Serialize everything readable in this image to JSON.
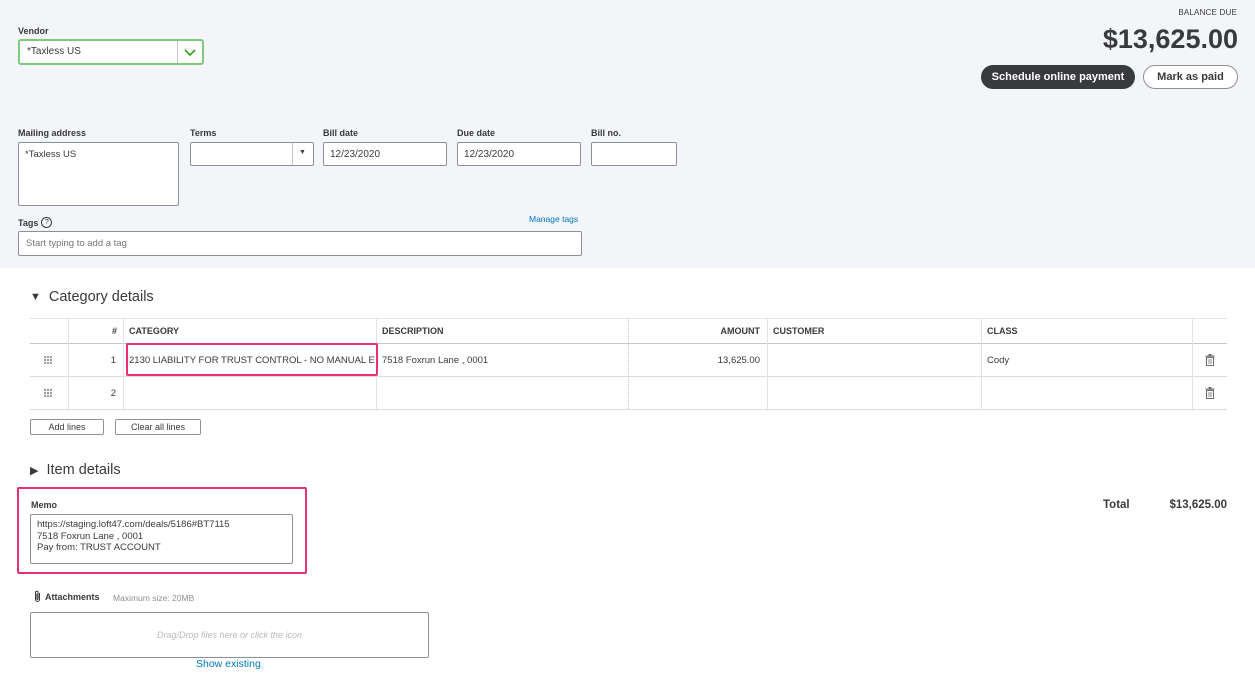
{
  "vendor": {
    "label": "Vendor",
    "value": "*Taxless US"
  },
  "balance": {
    "label": "BALANCE DUE",
    "amount": "$13,625.00"
  },
  "actions": {
    "schedule_payment": "Schedule online payment",
    "mark_paid": "Mark as paid"
  },
  "mailing": {
    "label": "Mailing address",
    "value": "*Taxless US"
  },
  "terms": {
    "label": "Terms",
    "value": ""
  },
  "bill_date": {
    "label": "Bill date",
    "value": "12/23/2020"
  },
  "due_date": {
    "label": "Due date",
    "value": "12/23/2020"
  },
  "bill_no": {
    "label": "Bill no.",
    "value": ""
  },
  "tags": {
    "label": "Tags",
    "placeholder": "Start typing to add a tag",
    "manage": "Manage tags"
  },
  "category_section": {
    "title": "Category details"
  },
  "table": {
    "headers": {
      "num": "#",
      "category": "CATEGORY",
      "description": "DESCRIPTION",
      "amount": "AMOUNT",
      "customer": "CUSTOMER",
      "class": "CLASS"
    },
    "rows": [
      {
        "num": "1",
        "category": "2130 LIABILITY FOR TRUST CONTROL - NO MANUAL E",
        "description": "7518  Foxrun Lane , 0001",
        "amount": "13,625.00",
        "customer": "",
        "class": "Cody"
      },
      {
        "num": "2",
        "category": "",
        "description": "",
        "amount": "",
        "customer": "",
        "class": ""
      }
    ]
  },
  "table_actions": {
    "add_lines": "Add lines",
    "clear_lines": "Clear all lines"
  },
  "item_section": {
    "title": "Item details"
  },
  "memo": {
    "label": "Memo",
    "line1": "https://staging.loft47.com/deals/5186#BT7115",
    "line2": "7518  Foxrun Lane , 0001",
    "line3": "Pay from: TRUST ACCOUNT"
  },
  "total": {
    "label": "Total",
    "amount": "$13,625.00"
  },
  "attachments": {
    "label": "Attachments",
    "max_size": "Maximum size: 20MB",
    "drop_hint": "Drag/Drop files here or click the icon",
    "show_existing": "Show existing"
  },
  "colors": {
    "highlight": "#e8316f",
    "vendor_border": "#7fc97f",
    "link": "#0077c5"
  }
}
